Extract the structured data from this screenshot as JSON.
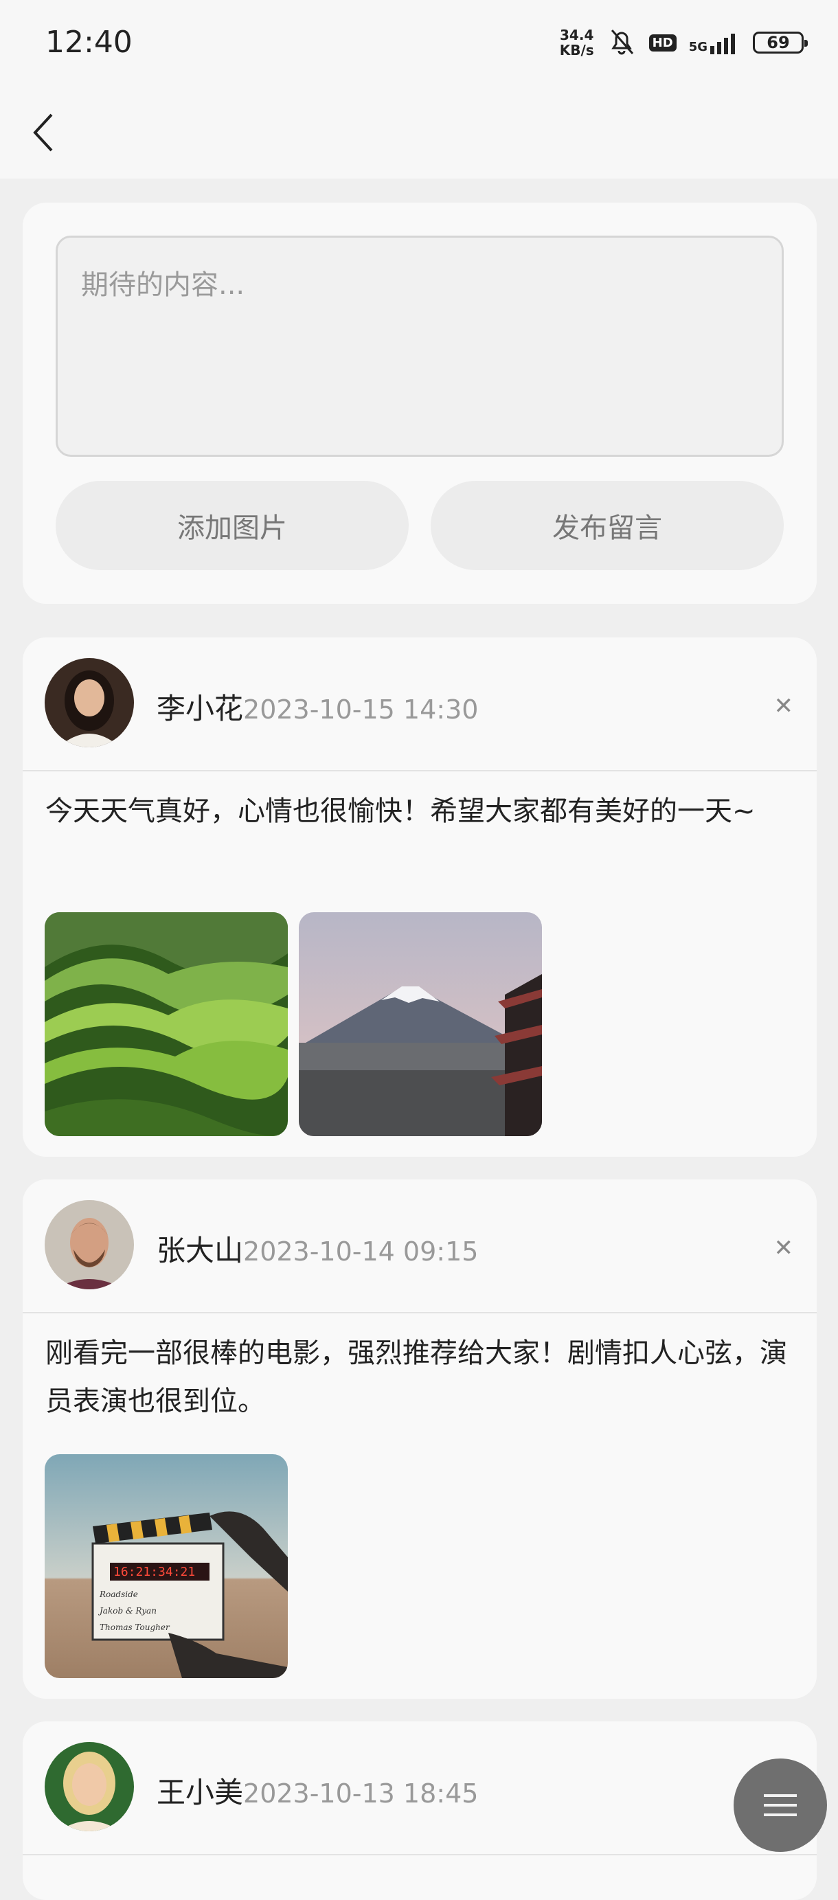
{
  "status_bar": {
    "time": "12:40",
    "net_speed_value": "34.4",
    "net_speed_unit": "KB/s",
    "hd_label": "HD",
    "network": "5G",
    "battery": "69"
  },
  "composer": {
    "placeholder": "期待的内容...",
    "add_image_label": "添加图片",
    "post_label": "发布留言"
  },
  "posts": [
    {
      "author": "李小花",
      "time": "2023-10-15 14:30",
      "text": "今天天气真好，心情也很愉快！希望大家都有美好的一天~"
    },
    {
      "author": "张大山",
      "time": "2023-10-14 09:15",
      "text": "刚看完一部很棒的电影，强烈推荐给大家！剧情扣人心弦，演员表演也很到位。"
    },
    {
      "author": "王小美",
      "time": "2023-10-13 18:45",
      "text": ""
    }
  ],
  "clapper_text": {
    "counter": "16:21:34:21",
    "line1": "Roadside",
    "line2": "Jakob & Ryan",
    "line3": "Thomas Tougher"
  },
  "colors": {
    "page_bg": "#efefef",
    "card_bg": "#f9f9f9",
    "button_bg": "#ececec",
    "fab_bg": "#6f6f6f"
  }
}
